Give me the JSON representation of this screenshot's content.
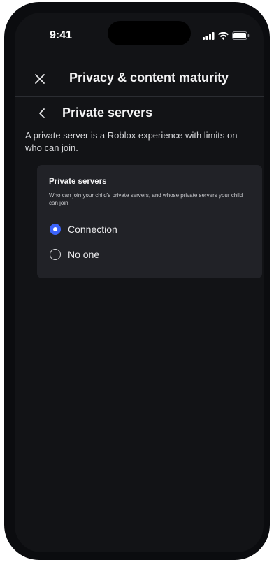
{
  "status_bar": {
    "time": "9:41",
    "icons": [
      "cellular-signal-icon",
      "wifi-icon",
      "battery-icon"
    ]
  },
  "header": {
    "close_icon": "close-icon",
    "title": "Privacy & content maturity"
  },
  "section": {
    "back_icon": "chevron-left-icon",
    "title": "Private servers",
    "description": "A private server is a Roblox experience with limits on who can join."
  },
  "card": {
    "title": "Private servers",
    "description": "Who can join your child's private servers, and whose private servers your child can join",
    "options": [
      {
        "label": "Connection",
        "selected": true
      },
      {
        "label": "No one",
        "selected": false
      }
    ]
  },
  "colors": {
    "accent": "#3c64fa",
    "background": "#121316",
    "card": "#212227"
  }
}
